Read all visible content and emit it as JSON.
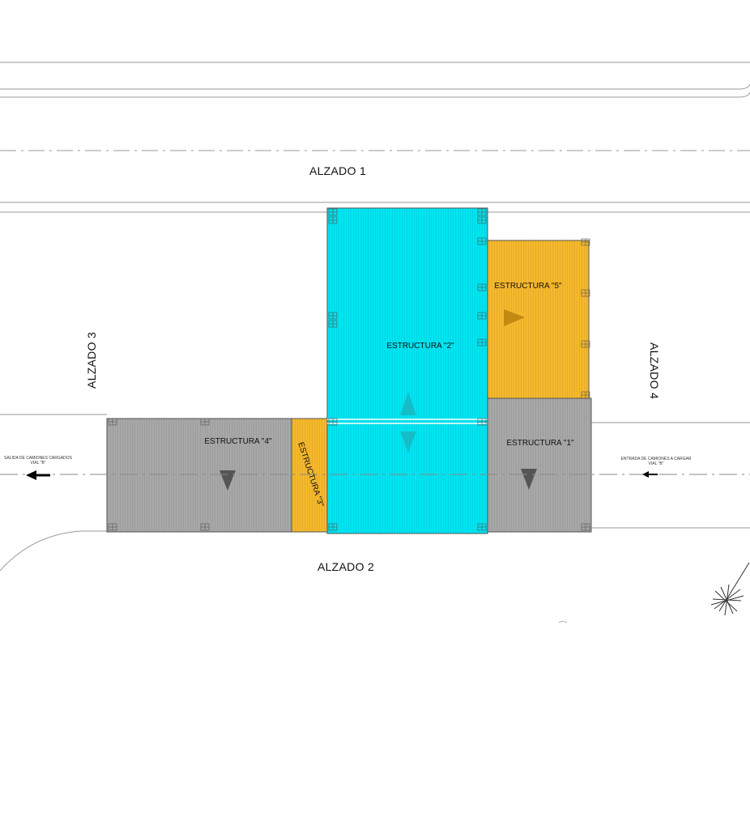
{
  "elevations": {
    "a1": "ALZADO 1",
    "a2": "ALZADO 2",
    "a3": "ALZADO 3",
    "a4": "ALZADO 4"
  },
  "structures": {
    "s1": "ESTRUCTURA \"1\"",
    "s2": "ESTRUCTURA \"2\"",
    "s3": "ESTRUCTURA \"3\"",
    "s4": "ESTRUCTURA \"4\"",
    "s5": "ESTRUCTURA \"5\""
  },
  "roads": {
    "exit_line1": "SALIDA DE CAMIONES CARGADOS",
    "exit_line2": "VIAL \"B\"",
    "entry_line1": "ENTRADA DE CAMIONES A CARGAR",
    "entry_line2": "VIAL \"B\""
  },
  "colors": {
    "cyan": "#00e5f2",
    "orange": "#f6b92c",
    "gray": "#a8a8a8",
    "line": "#9a9a9a"
  },
  "icons": {
    "north": "north-arrow-icon",
    "exit": "left-arrow-icon",
    "entry": "left-arrow-icon"
  }
}
